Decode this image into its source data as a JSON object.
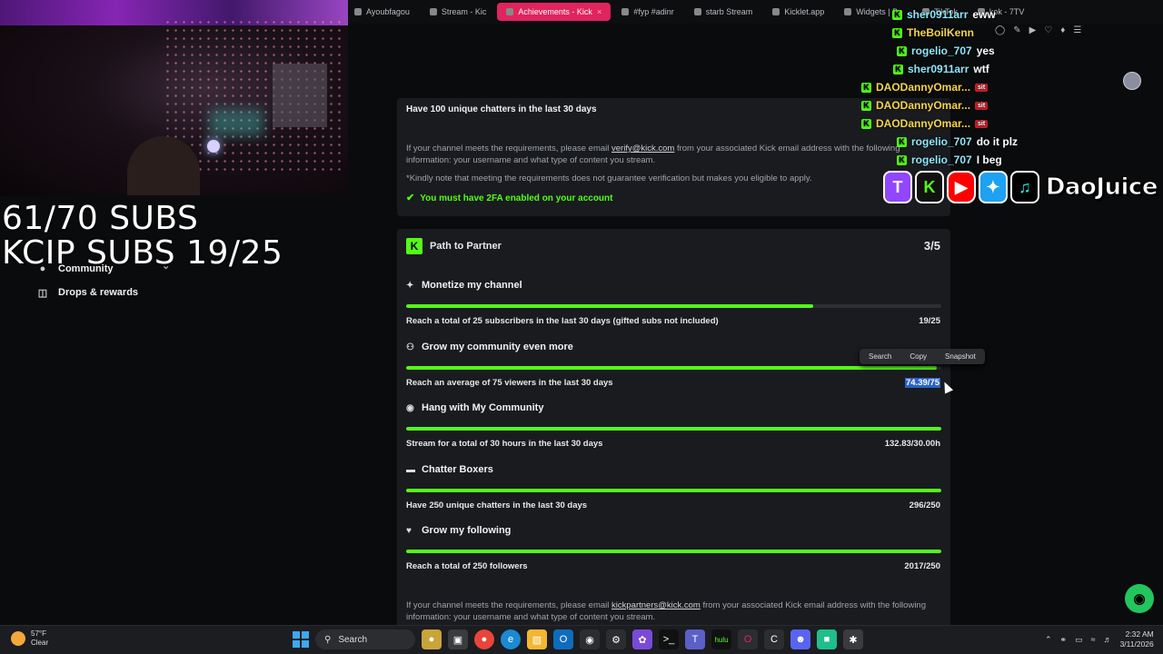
{
  "browser": {
    "tabs": [
      {
        "label": "Ayoubfagou",
        "active": false
      },
      {
        "label": "Stream - Kic",
        "active": false
      },
      {
        "label": "Achievements - Kick",
        "active": true
      },
      {
        "label": "#fyp #adinr",
        "active": false
      },
      {
        "label": "starb Stream",
        "active": false
      },
      {
        "label": "Kicklet.app",
        "active": false
      },
      {
        "label": "Widgets | Bo",
        "active": false
      },
      {
        "label": "TikTok",
        "active": false
      },
      {
        "label": "kok - 7TV",
        "active": false
      }
    ]
  },
  "overlay": {
    "subs_line1": "61/70 SUBS",
    "subs_line2": "KCIP SUBS 19/25",
    "brand": "DaoJuice"
  },
  "sidebar": {
    "items": [
      {
        "label": "Community",
        "icon": "users-icon"
      },
      {
        "label": "Drops & rewards",
        "icon": "gift-icon"
      }
    ]
  },
  "chat": {
    "messages": [
      {
        "user": "sher0911arr",
        "text": "eww",
        "gold": false,
        "badge": ""
      },
      {
        "user": "TheBoilKenn",
        "text": "",
        "gold": true,
        "badge": ""
      },
      {
        "user": "rogelio_707",
        "text": "yes",
        "gold": false,
        "badge": ""
      },
      {
        "user": "sher0911arr",
        "text": "wtf",
        "gold": false,
        "badge": ""
      },
      {
        "user": "DAODannyOmar...",
        "text": "",
        "gold": true,
        "badge": "sit"
      },
      {
        "user": "DAODannyOmar...",
        "text": "",
        "gold": true,
        "badge": "sit"
      },
      {
        "user": "DAODannyOmar...",
        "text": "",
        "gold": true,
        "badge": "sit"
      },
      {
        "user": "rogelio_707",
        "text": "do it plz",
        "gold": false,
        "badge": ""
      },
      {
        "user": "rogelio_707",
        "text": "I beg",
        "gold": false,
        "badge": ""
      }
    ]
  },
  "verification": {
    "requirement": "Have 100 unique chatters in the last 30 days",
    "email_prefix": "If your channel meets the requirements, please email ",
    "email": "verify@kick.com",
    "email_suffix": " from your associated Kick email address with the following information: your username and what type of content you stream.",
    "note": "*Kindly note that meeting the requirements does not guarantee verification but makes you eligible to apply.",
    "twofa": "You must have 2FA enabled on your account"
  },
  "partner": {
    "title": "Path to Partner",
    "count": "3/5",
    "sections": [
      {
        "title": "Monetize my channel",
        "icon": "sparkle-icon",
        "requirement": "Reach a total of 25 subscribers in the last 30 days (gifted subs not included)",
        "value": "19/25",
        "progress": 0.76,
        "selected": false
      },
      {
        "title": "Grow my community even more",
        "icon": "users-icon",
        "requirement": "Reach an average of 75 viewers in the last 30 days",
        "value": "74.39/75",
        "progress": 0.992,
        "selected": true
      },
      {
        "title": "Hang with My Community",
        "icon": "broadcast-icon",
        "requirement": "Stream for a total of 30 hours in the last 30 days",
        "value": "132.83/30.00h",
        "progress": 1.0,
        "selected": false
      },
      {
        "title": "Chatter Boxers",
        "icon": "chat-icon",
        "requirement": "Have 250 unique chatters in the last 30 days",
        "value": "296/250",
        "progress": 1.0,
        "selected": false
      },
      {
        "title": "Grow my following",
        "icon": "heart-icon",
        "requirement": "Reach a total of 250 followers",
        "value": "2017/250",
        "progress": 1.0,
        "selected": false
      }
    ],
    "footer_prefix": "If your channel meets the requirements, please email ",
    "footer_email": "kickpartners@kick.com",
    "footer_suffix": " from your associated Kick email address with the following information: your username and what type of content you stream."
  },
  "context_menu": {
    "items": [
      "Search",
      "Copy",
      "Snapshot"
    ]
  },
  "taskbar": {
    "temp": "57°F",
    "condition": "Clear",
    "search": "Search",
    "time": "2:32 AM",
    "date": "3/11/2026"
  },
  "colors": {
    "accent": "#53fc18",
    "panel": "#191b1f",
    "bg": "#0a0b0c",
    "tab_active": "#e0245e"
  }
}
